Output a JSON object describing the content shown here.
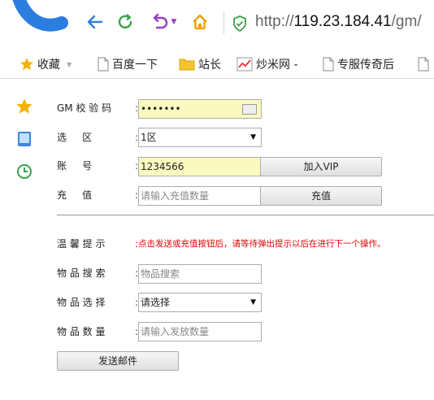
{
  "browser": {
    "address_prefix": "http://",
    "address_host": "119.23.184.41",
    "address_rest": "/gm/",
    "bookmarks": [
      {
        "label": "收藏",
        "icon": "star-icon"
      },
      {
        "label": "百度一下",
        "icon": "page-icon"
      },
      {
        "label": "站长",
        "icon": "folder-icon"
      },
      {
        "label": "炒米网 -",
        "icon": "chart-icon"
      },
      {
        "label": "专服传奇后",
        "icon": "page-icon"
      }
    ]
  },
  "form": {
    "gm_code": {
      "label": "GM 校 验 码",
      "value": "•••••••"
    },
    "region": {
      "label": "选     区",
      "value": "1区"
    },
    "account": {
      "label": "账     号",
      "value": "1234566",
      "button": "加入VIP"
    },
    "recharge": {
      "label": "充     值",
      "placeholder": "请输入充值数量",
      "button": "充值"
    },
    "tip": {
      "label": "温 馨 提 示",
      "text": "点击发送或充值按钮后，请等待弹出提示以后在进行下一个操作。"
    },
    "item_search": {
      "label": "物 品 搜 索",
      "placeholder": "物品搜索"
    },
    "item_select": {
      "label": "物 品 选 择",
      "value": "请选择"
    },
    "item_qty": {
      "label": "物 品 数 量",
      "placeholder": "请输入发放数量"
    },
    "send_button": "发送邮件"
  },
  "colors": {
    "tip": "#e60000",
    "highlight_field": "#fafac0",
    "accent_blue": "#3c86d6",
    "nav_green": "#3aa14a"
  }
}
